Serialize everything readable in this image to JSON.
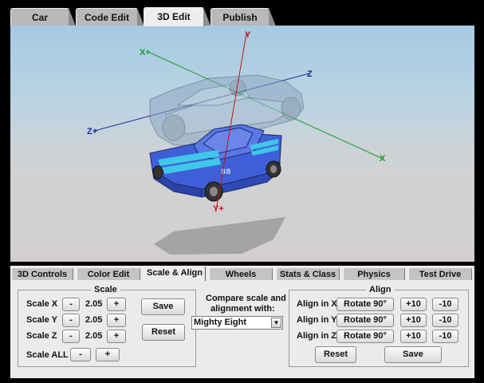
{
  "top_tabs": [
    {
      "label": "Car"
    },
    {
      "label": "Code Edit"
    },
    {
      "label": "3D Edit",
      "active": true
    },
    {
      "label": "Publish"
    }
  ],
  "viewport": {
    "axis_labels": {
      "x_pos": "X+",
      "x": "X",
      "y": "Y",
      "y_pos": "Y+",
      "z": "Z",
      "z_pos": "Z+"
    },
    "colors": {
      "x_axis": "#1a9a2a",
      "y_axis": "#c01515",
      "z_axis": "#1a2aa0",
      "car_body": "#4d6de0",
      "stripe": "#3fc8e8"
    }
  },
  "sub_tabs": [
    {
      "label": "3D Controls"
    },
    {
      "label": "Color Edit"
    },
    {
      "label": "Scale & Align",
      "active": true
    },
    {
      "label": "Wheels"
    },
    {
      "label": "Stats & Class"
    },
    {
      "label": "Physics"
    },
    {
      "label": "Test Drive"
    }
  ],
  "scale": {
    "title": "Scale",
    "rows": [
      {
        "label": "Scale X",
        "minus": "-",
        "value": "2.05",
        "plus": "+"
      },
      {
        "label": "Scale Y",
        "minus": "-",
        "value": "2.05",
        "plus": "+"
      },
      {
        "label": "Scale Z",
        "minus": "-",
        "value": "2.05",
        "plus": "+"
      }
    ],
    "all": {
      "label": "Scale ALL",
      "minus": "-",
      "plus": "+"
    },
    "save_label": "Save",
    "reset_label": "Reset"
  },
  "compare": {
    "line1": "Compare scale and",
    "line2": "alignment with:",
    "selected": "Mighty Eight"
  },
  "align": {
    "title": "Align",
    "rows": [
      {
        "label": "Align in X",
        "rotate": "Rotate 90°",
        "plus10": "+10",
        "minus10": "-10"
      },
      {
        "label": "Align in Y",
        "rotate": "Rotate 90°",
        "plus10": "+10",
        "minus10": "-10"
      },
      {
        "label": "Align in Z",
        "rotate": "Rotate 90°",
        "plus10": "+10",
        "minus10": "-10"
      }
    ],
    "reset_label": "Reset",
    "save_label": "Save"
  }
}
